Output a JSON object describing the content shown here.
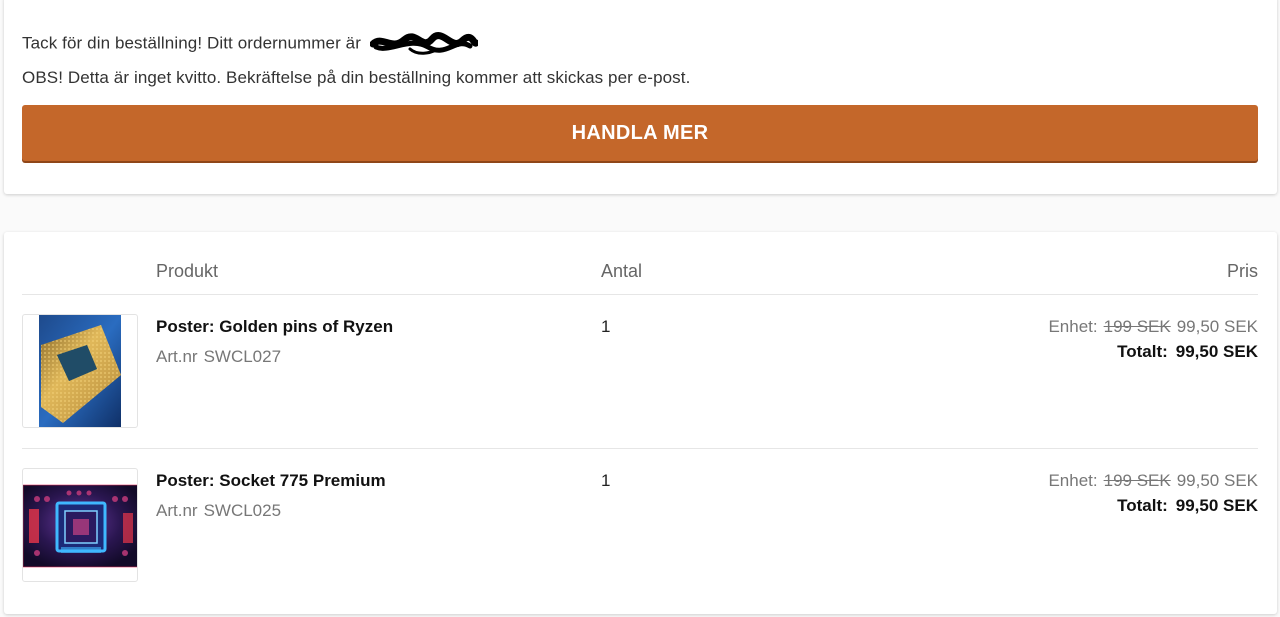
{
  "confirmation": {
    "thanks_text": "Tack för din beställning! Ditt ordernummer är",
    "notice_text": "OBS! Detta är inget kvitto. Bekräftelse på din beställning kommer att skickas per e-post.",
    "shop_more_label": "HANDLA MER"
  },
  "table": {
    "headers": {
      "product": "Produkt",
      "quantity": "Antal",
      "price": "Pris"
    },
    "items": [
      {
        "name": "Poster: Golden pins of Ryzen",
        "art_label": "Art.nr",
        "art_number": "SWCL027",
        "quantity": "1",
        "unit_label": "Enhet:",
        "old_price": "199 SEK",
        "unit_price": "99,50 SEK",
        "total_label": "Totalt:",
        "total_price": "99,50 SEK",
        "image_icon": "cpu-golden-pins-image"
      },
      {
        "name": "Poster: Socket 775 Premium",
        "art_label": "Art.nr",
        "art_number": "SWCL025",
        "quantity": "1",
        "unit_label": "Enhet:",
        "old_price": "199 SEK",
        "unit_price": "99,50 SEK",
        "total_label": "Totalt:",
        "total_price": "99,50 SEK",
        "image_icon": "cpu-socket-image"
      }
    ]
  },
  "colors": {
    "accent": "#c4672a",
    "text": "#222222",
    "muted": "#777777"
  }
}
